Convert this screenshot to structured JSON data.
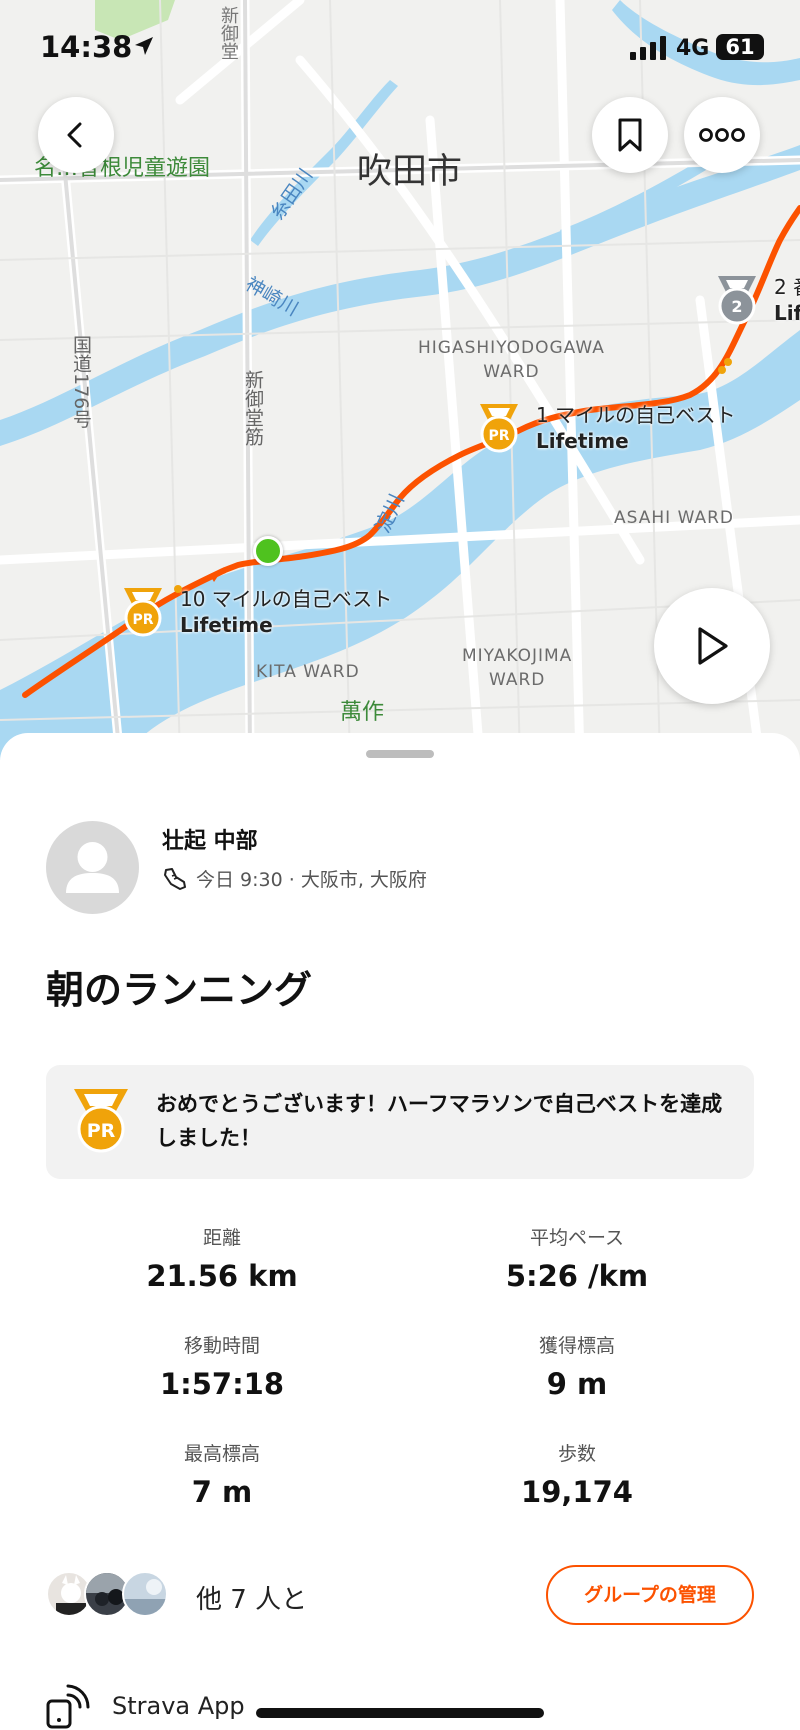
{
  "status_bar": {
    "time": "14:38",
    "network": "4G",
    "battery": "61"
  },
  "map": {
    "labels": {
      "city": "吹田市",
      "park": "名…曽根児童遊園",
      "river_itachi": "糸田川",
      "river_kanzaki": "神崎川",
      "road_176": "国道176号",
      "road_shinmido": "新御堂筋",
      "ward_higashi_line1": "HIGASHIYODOGAWA",
      "ward_higashi_line2": "WARD",
      "ward_asahi": "ASAHI WARD",
      "ward_miyakojima_line1": "MIYAKOJIMA",
      "ward_miyakojima_line2": "WARD",
      "ward_kita": "KITA WARD",
      "park_mansaku": "萬作",
      "river_yodo": "淀川",
      "road_top": "新御堂"
    },
    "pr_markers": [
      {
        "badge": "PR",
        "title": "1 マイルの自己ベスト",
        "subtitle": "Lifetime"
      },
      {
        "badge": "PR",
        "title": "10 マイルの自己ベスト",
        "subtitle": "Lifetime"
      },
      {
        "badge": "2",
        "title": "2 番",
        "subtitle": "Lif"
      }
    ],
    "route_color": "#fc5200",
    "start_color": "#4fc21f"
  },
  "buttons": {
    "back": "back",
    "bookmark": "bookmark",
    "more": "more",
    "play": "play"
  },
  "activity": {
    "athlete_name": "壮起 中部",
    "meta": "今日 9:30 · 大阪市, 大阪府",
    "title": "朝のランニング",
    "pr_message": "おめでとうございます！ハーフマラソンで自己ベストを達成しました！",
    "stats": [
      {
        "label": "距離",
        "value": "21.56 km"
      },
      {
        "label": "平均ペース",
        "value": "5:26 /km"
      },
      {
        "label": "移動時間",
        "value": "1:57:18"
      },
      {
        "label": "獲得標高",
        "value": "9 m"
      },
      {
        "label": "最高標高",
        "value": "7 m"
      },
      {
        "label": "歩数",
        "value": "19,174"
      }
    ]
  },
  "group": {
    "text": "他 7 人と",
    "button": "グループの管理"
  },
  "device": {
    "name": "Strava App"
  },
  "colors": {
    "accent": "#fc5200",
    "pr_gold": "#f0a30a",
    "water": "#a9d8f2",
    "park": "#c8e6b5"
  }
}
